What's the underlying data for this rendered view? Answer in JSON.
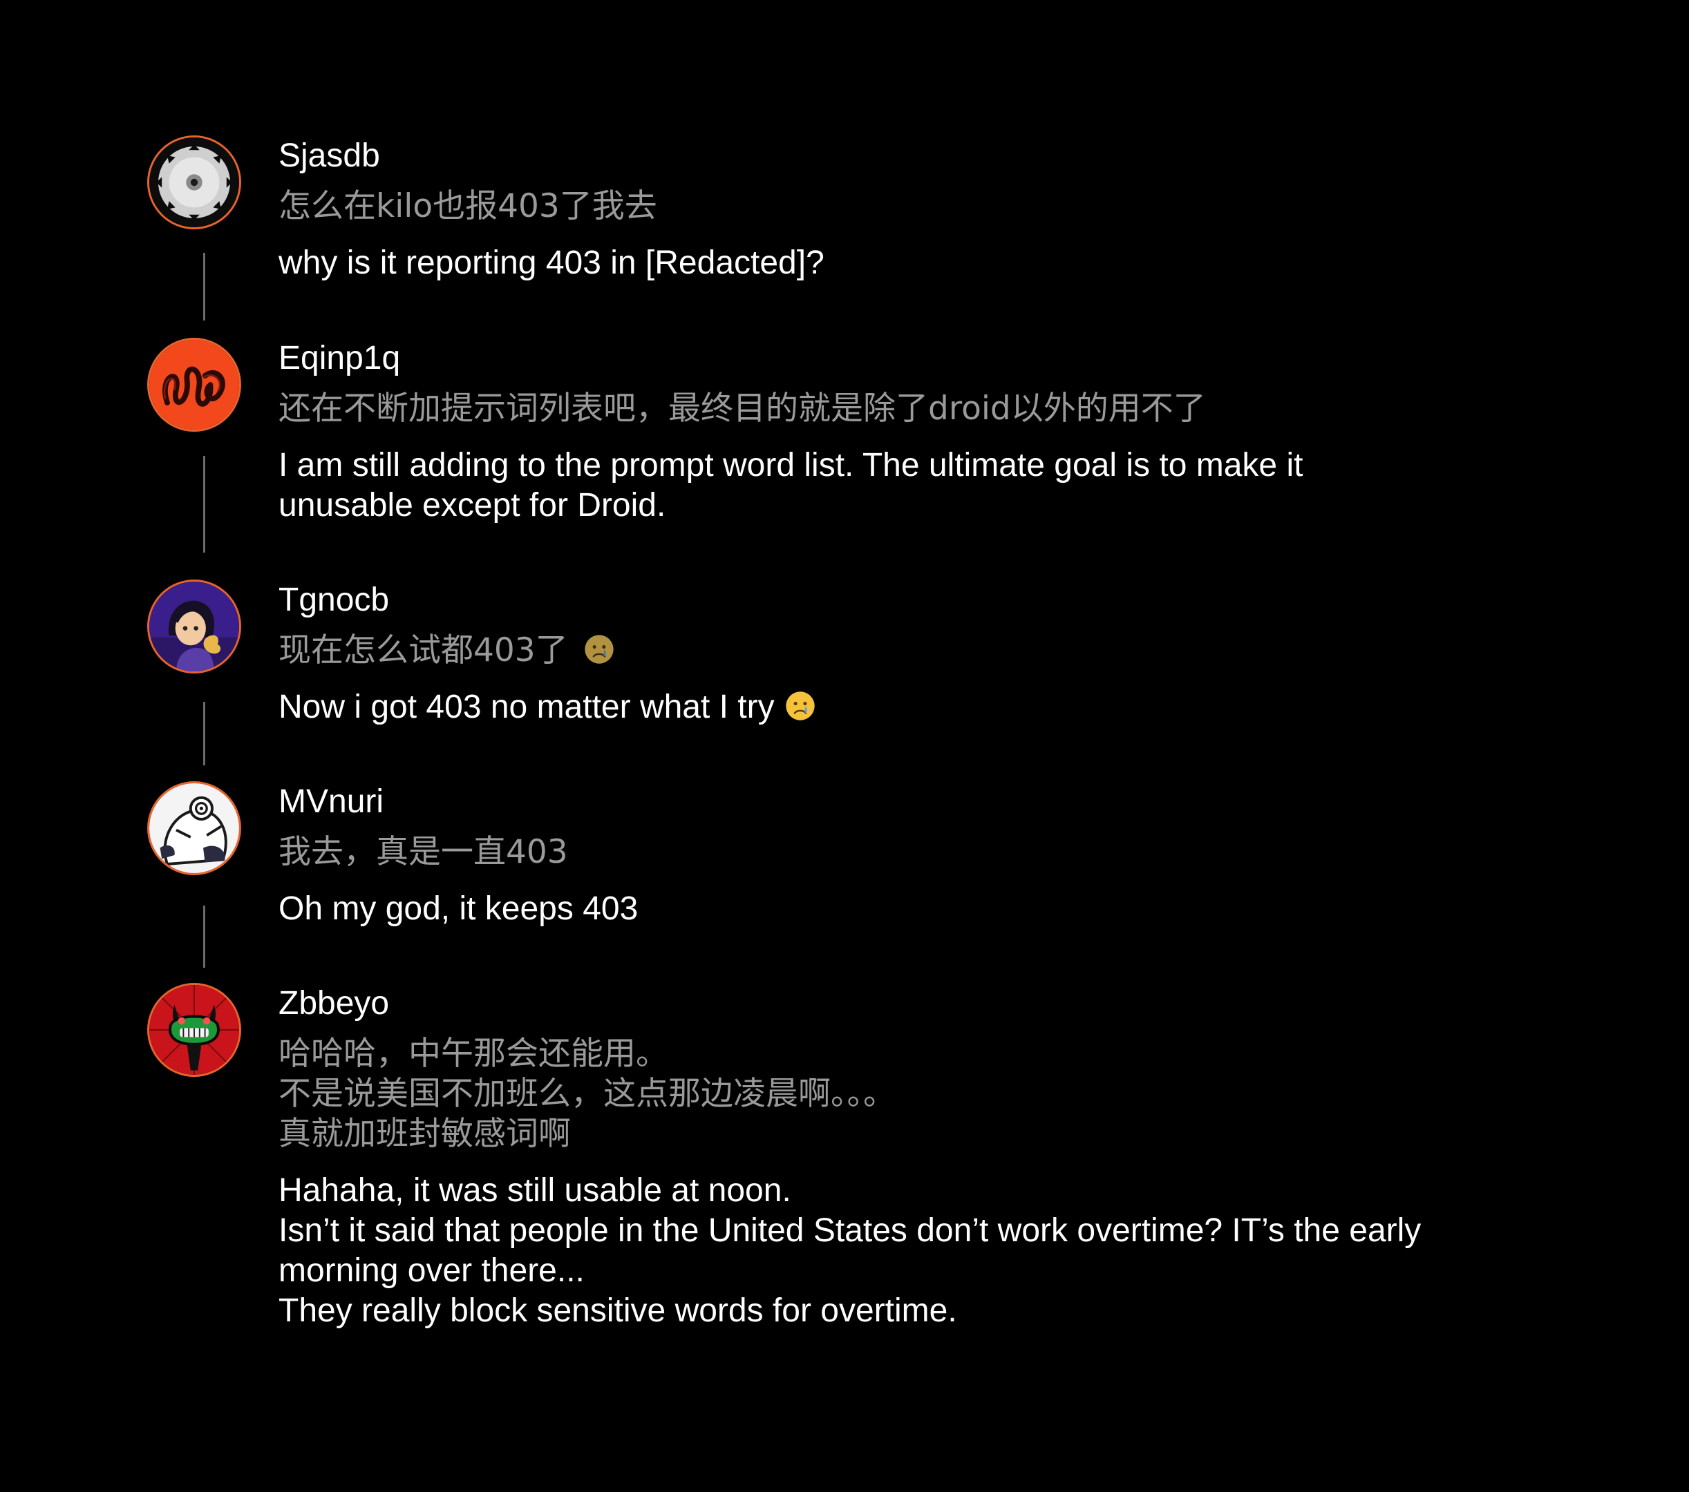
{
  "accent_color": "#e8642c",
  "comments": [
    {
      "username": "Sjasdb",
      "avatar": "circular-saw-blade-avatar",
      "original": "怎么在kilo也报403了我去",
      "translation": "why is it reporting 403 in [Redacted]?"
    },
    {
      "username": "Eqinp1q",
      "avatar": "orange-abstract-coil-avatar",
      "original": "还在不断加提示词列表吧，最终目的就是除了droid以外的用不了",
      "translation": "I am still adding to the prompt word list. The ultimate goal is to make it\nunusable except for Droid."
    },
    {
      "username": "Tgnocb",
      "avatar": "anime-character-avatar",
      "original": "现在怎么试都403了",
      "original_emoji": "crying-face-emoji",
      "translation": "Now i got 403 no matter what I try",
      "translation_emoji": "crying-face-emoji"
    },
    {
      "username": "MVnuri",
      "avatar": "white-cartoon-creature-avatar",
      "original": "我去，真是一直403",
      "translation": "Oh my god, it keeps 403"
    },
    {
      "username": "Zbbeyo",
      "avatar": "red-demon-mask-avatar",
      "original": "哈哈哈，中午那会还能用。\n不是说美国不加班么，这点那边凌晨啊。。。\n真就加班封敏感词啊",
      "translation": "Hahaha, it was still usable at noon.\nIsn’t it said that people in the United States don’t work overtime? IT’s the early\nmorning over there...\nThey really block sensitive words for overtime."
    }
  ]
}
